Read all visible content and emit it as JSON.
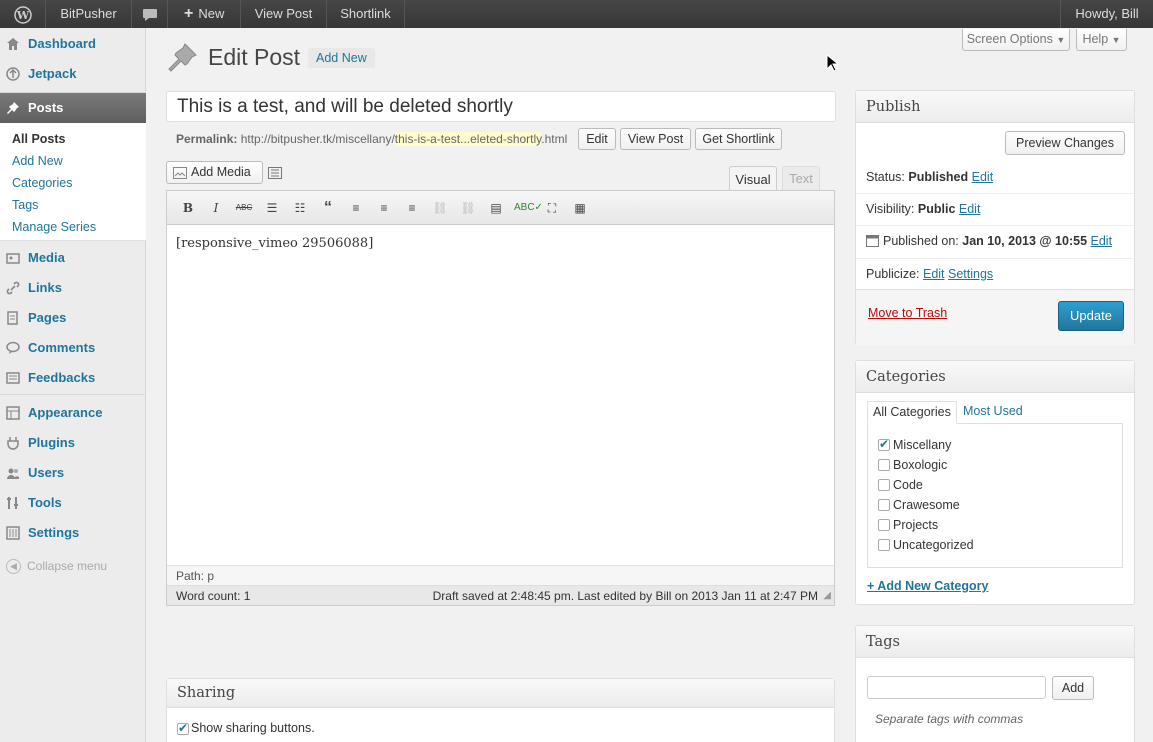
{
  "adminbar": {
    "site_name": "BitPusher",
    "new_label": "New",
    "view_post": "View Post",
    "shortlink": "Shortlink",
    "howdy": "Howdy, Bill"
  },
  "sidebar": {
    "dashboard": "Dashboard",
    "jetpack": "Jetpack",
    "posts": "Posts",
    "submenu": [
      "All Posts",
      "Add New",
      "Categories",
      "Tags",
      "Manage Series"
    ],
    "media": "Media",
    "links": "Links",
    "pages": "Pages",
    "comments": "Comments",
    "feedbacks": "Feedbacks",
    "appearance": "Appearance",
    "plugins": "Plugins",
    "users": "Users",
    "tools": "Tools",
    "settings": "Settings",
    "collapse": "Collapse menu"
  },
  "header": {
    "title": "Edit Post",
    "add_new": "Add New",
    "screen_options": "Screen Options",
    "help": "Help"
  },
  "post": {
    "title": "This is a test, and will be deleted shortly",
    "permalink_label": "Permalink:",
    "permalink_base": "http://bitpusher.tk/miscellany/",
    "permalink_slug": "this-is-a-test...eleted-shortly",
    "permalink_ext": ".html",
    "edit_btn": "Edit",
    "view_btn": "View Post",
    "shortlink_btn": "Get Shortlink"
  },
  "editor": {
    "add_media": "Add Media",
    "tab_visual": "Visual",
    "tab_text": "Text",
    "content": "[responsive_vimeo 29506088]",
    "path": "Path: p",
    "word_count": "Word count: 1",
    "draft_saved": "Draft saved at 2:48:45 pm. Last edited by Bill on 2013 Jan 11 at 2:47 PM"
  },
  "sharing": {
    "title": "Sharing",
    "show_buttons": "Show sharing buttons."
  },
  "publish": {
    "title": "Publish",
    "preview": "Preview Changes",
    "status_label": "Status:",
    "status_value": "Published",
    "edit": "Edit",
    "visibility_label": "Visibility:",
    "visibility_value": "Public",
    "published_label": "Published on:",
    "published_value": "Jan 10, 2013 @ 10:55",
    "publicize_label": "Publicize:",
    "publicize_edit": "Edit",
    "publicize_settings": "Settings",
    "trash": "Move to Trash",
    "update": "Update"
  },
  "categories": {
    "title": "Categories",
    "tab_all": "All Categories",
    "tab_used": "Most Used",
    "items": [
      {
        "label": "Miscellany",
        "checked": true
      },
      {
        "label": "Boxologic",
        "checked": false
      },
      {
        "label": "Code",
        "checked": false
      },
      {
        "label": "Crawesome",
        "checked": false
      },
      {
        "label": "Projects",
        "checked": false
      },
      {
        "label": "Uncategorized",
        "checked": false
      }
    ],
    "add_new": "+ Add New Category"
  },
  "tags": {
    "title": "Tags",
    "add": "Add",
    "hint": "Separate tags with commas",
    "input_value": ""
  },
  "colors": {
    "accent": "#21759b",
    "update_btn": "#2e8bbf",
    "trash": "#bc0b0b",
    "highlight": "#fffbcc"
  }
}
